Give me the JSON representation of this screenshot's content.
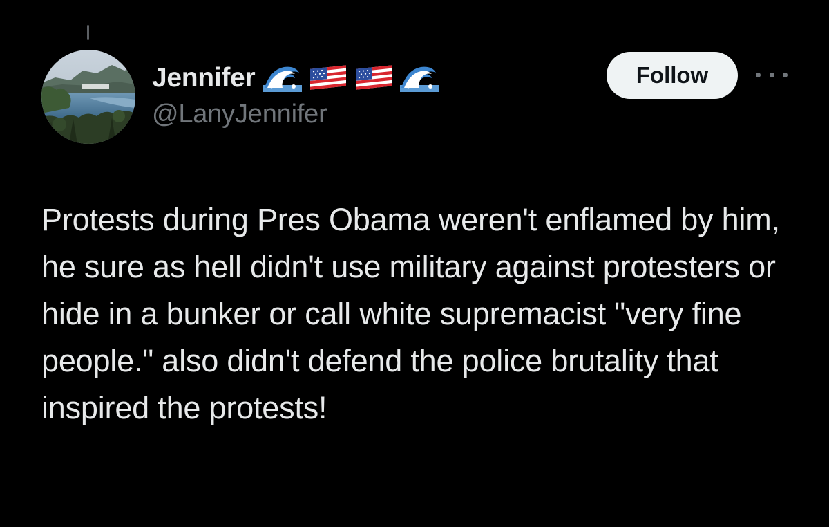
{
  "tweet": {
    "author": {
      "display_name": "Jennifer",
      "name_emojis": [
        "water-wave-emoji",
        "us-flag-emoji",
        "us-flag-emoji",
        "water-wave-emoji"
      ],
      "handle": "@LanyJennifer",
      "avatar": "landscape-lake-avatar"
    },
    "follow_label": "Follow",
    "more_icon": "more-options-icon",
    "text": "Protests during Pres Obama weren't enflamed by him, he sure as hell didn't use military against protesters or hide in a bunker or call white supremacist \"very fine people.\" also didn't defend the police brutality that inspired the protests!"
  },
  "colors": {
    "background": "#000000",
    "primary_text": "#e7e9ea",
    "secondary_text": "#71767b",
    "follow_bg": "#eff3f4",
    "follow_text": "#0f1419"
  }
}
